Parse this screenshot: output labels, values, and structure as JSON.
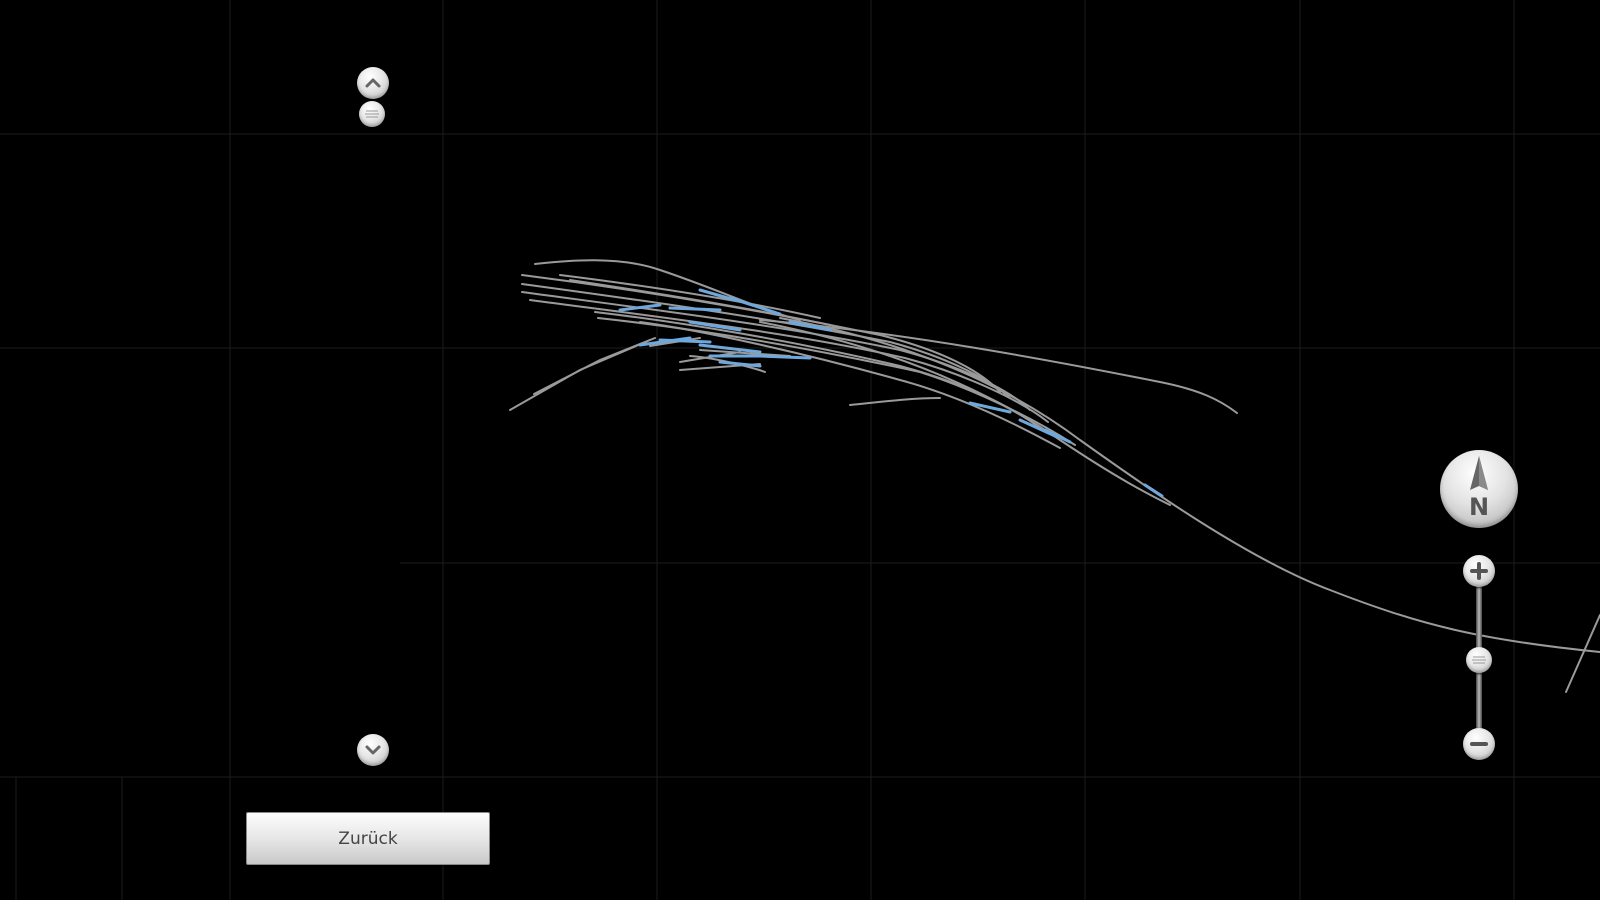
{
  "buttons": {
    "back_label": "Zurück"
  },
  "compass": {
    "label": "N"
  },
  "icons": {
    "scroll_up": "chevron-up-icon",
    "scroll_handle": "grip-icon",
    "scroll_down": "chevron-down-icon",
    "compass": "north-arrow-icon",
    "zoom_in": "plus-icon",
    "zoom_thumb": "grip-icon",
    "zoom_out": "minus-icon"
  },
  "colors": {
    "background": "#000000",
    "grid": "#1c1c1c",
    "track": "#9a9a9a",
    "track_highlight": "#6fa8dc",
    "button_text": "#444444"
  }
}
